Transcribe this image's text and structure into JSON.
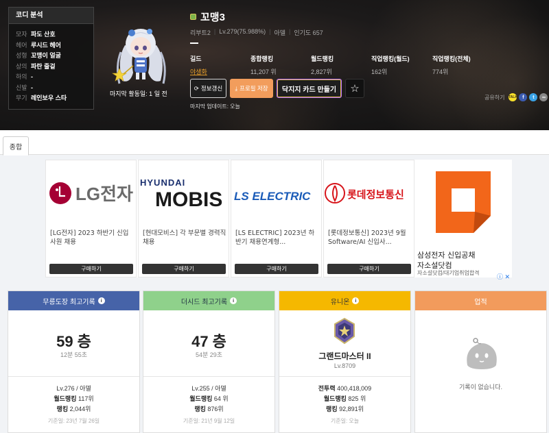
{
  "coordi": {
    "title": "코디 분석",
    "items": [
      {
        "k": "모자",
        "v": "파도 산호"
      },
      {
        "k": "헤어",
        "v": "루시드 헤어"
      },
      {
        "k": "성형",
        "v": "꼬맹이 얼굴"
      },
      {
        "k": "상의",
        "v": "파란 줄겉"
      },
      {
        "k": "하의",
        "v": "-"
      },
      {
        "k": "신발",
        "v": "-"
      },
      {
        "k": "무기",
        "v": "레인보우 스타"
      }
    ]
  },
  "character": {
    "name": "꼬맹3",
    "job": "리부트2",
    "level": "Lv.279(75.988%)",
    "class": "아델",
    "popularity": "인기도 657",
    "last_active": "마지막 활동일: 1 일 전"
  },
  "stats": [
    {
      "label": "길드",
      "value": "야생화"
    },
    {
      "label": "종합랭킹",
      "value": "11,207 위"
    },
    {
      "label": "월드랭킹",
      "value": "2,827위"
    },
    {
      "label": "직업랭킹(월드)",
      "value": "162위"
    },
    {
      "label": "직업랭킹(전체)",
      "value": "774위"
    }
  ],
  "buttons": {
    "refresh": "정보갱신",
    "save": "프로필 저장",
    "card": "닥지지 카드 만들기"
  },
  "last_update": "마지막 업데이트: 오늘",
  "share": {
    "label": "공유하기",
    "kakao": "TALK",
    "fb": "f",
    "tw": "t",
    "link": "∞"
  },
  "tabs": [
    "종합"
  ],
  "ads": [
    {
      "logo": "LG전자",
      "text": "[LG전자] 2023 하반기 신입사원 채용",
      "buy": "구매하기"
    },
    {
      "logo_top": "HYUNDAI",
      "logo": "MOBIS",
      "text": "[현대모비스] 각 부문별 경력직 채용",
      "buy": "구매하기"
    },
    {
      "logo": "LS ELECTRIC",
      "text": "[LS ELECTRIC] 2023년 하반기 채용연계형...",
      "buy": "구매하기"
    },
    {
      "logo": "롯데정보통신",
      "text": "[롯데정보통신] 2023년 9월 Software/AI 신입사...",
      "buy": "구매하기"
    }
  ],
  "samsung_ad": {
    "title_line1": "삼성전자 신입공채",
    "title_line2": "자소설닷컴",
    "sub": "자소설닷컴/대기업취업합격",
    "info": "ⓘ ✕"
  },
  "cards": {
    "dojo": {
      "title": "무릉도장 최고기록",
      "floor": "59 층",
      "time": "12분 55초",
      "lv_class": "Lv.276 / 아델",
      "world_rank_label": "월드랭킹",
      "world_rank": "117위",
      "rank_label": "랭킹",
      "rank": "2,044위",
      "date": "기준일: 23년 7월 26일"
    },
    "seed": {
      "title": "더시드 최고기록",
      "floor": "47 층",
      "time": "54분 29초",
      "lv_class": "Lv.255 / 아델",
      "world_rank_label": "월드랭킹",
      "world_rank": "64 위",
      "rank_label": "랭킹",
      "rank": "876위",
      "date": "기준일: 21년 9월 12일"
    },
    "union": {
      "title": "유니온",
      "name": "그랜드마스터 II",
      "lv": "Lv.8709",
      "power_label": "전투력",
      "power": "400,418,009",
      "world_rank_label": "월드랭킹",
      "world_rank": "825 위",
      "rank_label": "랭킹",
      "rank": "92,891위",
      "date": "기준일: 오늘"
    },
    "achieve": {
      "title": "업적",
      "empty": "기록이 없습니다."
    }
  },
  "icons": {
    "info": "i",
    "star": "☆",
    "refresh": "⟳",
    "save": "⤓"
  },
  "colors": {
    "dojo": "#4663a8",
    "seed": "#8fd18b",
    "union": "#f5b800",
    "achieve": "#f29b5c",
    "guild": "#e8a02a"
  }
}
